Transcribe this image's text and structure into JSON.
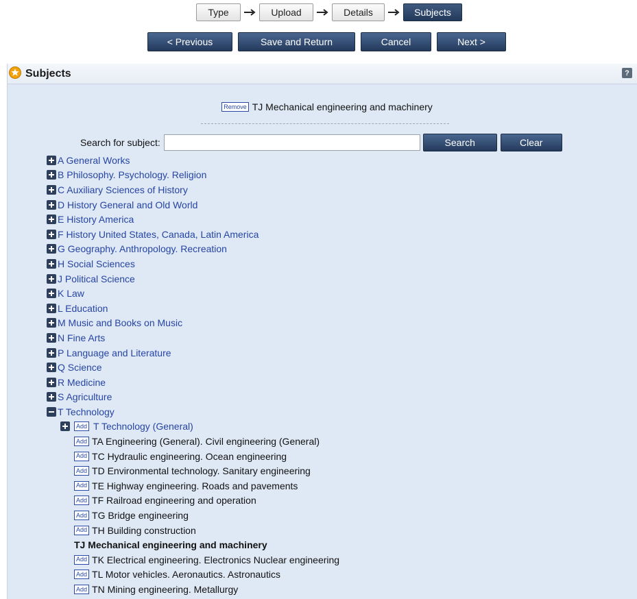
{
  "steps": {
    "type": "Type",
    "upload": "Upload",
    "details": "Details",
    "subjects": "Subjects"
  },
  "actions": {
    "previous": "< Previous",
    "save_return": "Save and Return",
    "cancel": "Cancel",
    "next": "Next >"
  },
  "panel": {
    "title": "Subjects",
    "help": "?",
    "selected_remove_label": "Remove",
    "selected_subject": "TJ Mechanical engineering and machinery"
  },
  "search": {
    "label": "Search for subject:",
    "value": "",
    "search_button": "Search",
    "clear_button": "Clear"
  },
  "tree": {
    "top": [
      "A General Works",
      "B Philosophy. Psychology. Religion",
      "C Auxiliary Sciences of History",
      "D History General and Old World",
      "E History America",
      "F History United States, Canada, Latin America",
      "G Geography. Anthropology. Recreation",
      "H Social Sciences",
      "J Political Science",
      "K Law",
      "L Education",
      "M Music and Books on Music",
      "N Fine Arts",
      "P Language and Literature",
      "Q Science",
      "R Medicine",
      "S Agriculture"
    ],
    "expanded": "T Technology",
    "add_label": "Add",
    "first_child": "T Technology (General)",
    "children_before": [
      "TA Engineering (General). Civil engineering (General)",
      "TC Hydraulic engineering. Ocean engineering",
      "TD Environmental technology. Sanitary engineering",
      "TE Highway engineering. Roads and pavements",
      "TF Railroad engineering and operation",
      "TG Bridge engineering",
      "TH Building construction"
    ],
    "current": "TJ Mechanical engineering and machinery",
    "children_after": [
      "TK Electrical engineering. Electronics Nuclear engineering",
      "TL Motor vehicles. Aeronautics. Astronautics",
      "TN Mining engineering. Metallurgy"
    ]
  }
}
